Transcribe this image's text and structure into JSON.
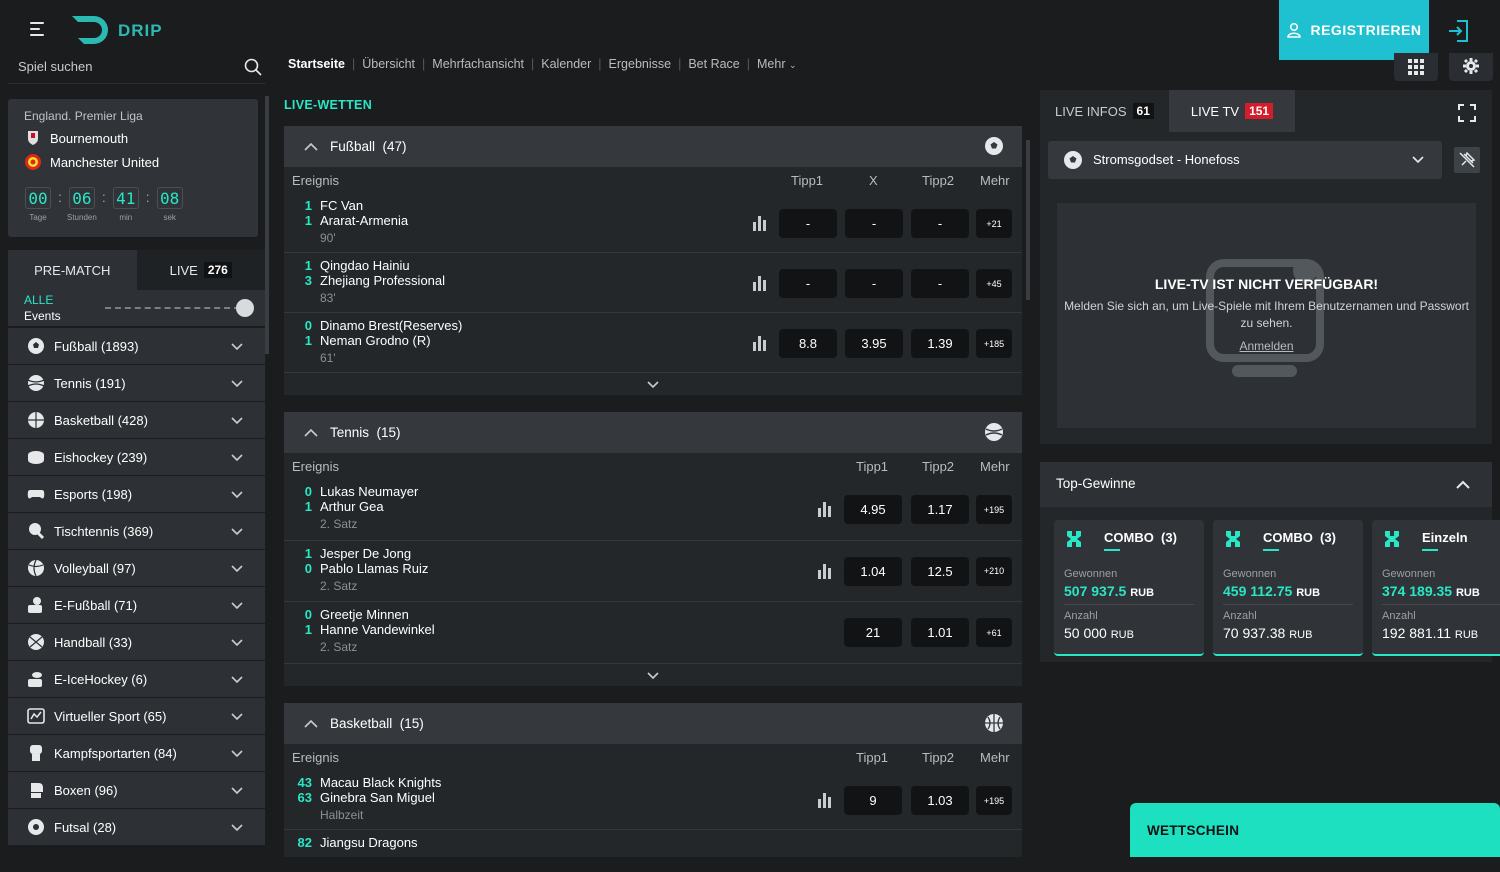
{
  "header": {
    "logo_text": "DRIP",
    "register_label": "REGISTRIEREN",
    "accent_color": "#1fc0cf"
  },
  "search": {
    "placeholder": "Spiel suchen"
  },
  "topnav": [
    "Startseite",
    "Übersicht",
    "Mehrfachansicht",
    "Kalender",
    "Ergebnisse",
    "Bet Race",
    "Mehr"
  ],
  "live_card": {
    "league": "England. Premier Liga",
    "team1": "Bournemouth",
    "team2": "Manchester United",
    "countdown": [
      {
        "value": "00",
        "label": "Tage"
      },
      {
        "value": "06",
        "label": "Stunden"
      },
      {
        "value": "41",
        "label": "min"
      },
      {
        "value": "08",
        "label": "sek"
      }
    ]
  },
  "mode_tabs": {
    "prematch": "PRE-MATCH",
    "live": "LIVE",
    "live_count": "276"
  },
  "filter": {
    "alle": "ALLE",
    "events": "Events"
  },
  "sports": [
    {
      "label": "Fußball (1893)",
      "icon": "soccer-ball-icon"
    },
    {
      "label": "Tennis (191)",
      "icon": "tennis-ball-icon"
    },
    {
      "label": "Basketball (428)",
      "icon": "basketball-icon"
    },
    {
      "label": "Eishockey (239)",
      "icon": "hockey-puck-icon"
    },
    {
      "label": "Esports (198)",
      "icon": "gamepad-icon"
    },
    {
      "label": "Tischtennis (369)",
      "icon": "table-tennis-icon"
    },
    {
      "label": "Volleyball (97)",
      "icon": "volleyball-icon"
    },
    {
      "label": "E-Fußball (71)",
      "icon": "e-football-icon"
    },
    {
      "label": "Handball (33)",
      "icon": "handball-icon"
    },
    {
      "label": "E-IceHockey (6)",
      "icon": "e-icehockey-icon"
    },
    {
      "label": "Virtueller Sport (65)",
      "icon": "virtual-sport-icon"
    },
    {
      "label": "Kampfsportarten (84)",
      "icon": "martial-arts-icon"
    },
    {
      "label": "Boxen (96)",
      "icon": "boxing-glove-icon"
    },
    {
      "label": "Futsal (28)",
      "icon": "futsal-ball-icon"
    }
  ],
  "live_heading": "LIVE-WETTEN",
  "football": {
    "title": "Fußball  (47)",
    "cols": {
      "event": "Ereignis",
      "t1": "Tipp1",
      "x": "X",
      "t2": "Tipp2",
      "more": "Mehr"
    },
    "events": [
      {
        "s1": "1",
        "team1": "FC Van",
        "s2": "1",
        "team2": "Ararat-Armenia",
        "time": "90'",
        "o1": "-",
        "ox": "-",
        "o2": "-",
        "more": "+21"
      },
      {
        "s1": "1",
        "team1": "Qingdao Hainiu",
        "s2": "3",
        "team2": "Zhejiang Professional",
        "time": "83'",
        "o1": "-",
        "ox": "-",
        "o2": "-",
        "more": "+45"
      },
      {
        "s1": "0",
        "team1": "Dinamo Brest(Reserves)",
        "s2": "1",
        "team2": "Neman Grodno (R)",
        "time": "61'",
        "o1": "8.8",
        "ox": "3.95",
        "o2": "1.39",
        "more": "+185"
      }
    ]
  },
  "tennis": {
    "title": "Tennis  (15)",
    "cols": {
      "event": "Ereignis",
      "t1": "Tipp1",
      "t2": "Tipp2",
      "more": "Mehr"
    },
    "events": [
      {
        "s1": "0",
        "team1": "Lukas Neumayer",
        "s2": "1",
        "team2": "Arthur Gea",
        "time": "2. Satz",
        "o1": "4.95",
        "o2": "1.17",
        "more": "+195"
      },
      {
        "s1": "1",
        "team1": "Jesper De Jong",
        "s2": "0",
        "team2": "Pablo Llamas Ruiz",
        "time": "2. Satz",
        "o1": "1.04",
        "o2": "12.5",
        "more": "+210"
      },
      {
        "s1": "0",
        "team1": "Greetje Minnen",
        "s2": "1",
        "team2": "Hanne Vandewinkel",
        "time": "2. Satz",
        "o1": "21",
        "o2": "1.01",
        "more": "+61"
      }
    ]
  },
  "basketball": {
    "title": "Basketball  (15)",
    "cols": {
      "event": "Ereignis",
      "t1": "Tipp1",
      "t2": "Tipp2",
      "more": "Mehr"
    },
    "events": [
      {
        "s1": "43",
        "team1": "Macau Black Knights",
        "s2": "63",
        "team2": "Ginebra San Miguel",
        "time": "Halbzeit",
        "o1": "9",
        "o2": "1.03",
        "more": "+195"
      },
      {
        "s1": "82",
        "team1": "Jiangsu Dragons"
      }
    ]
  },
  "right": {
    "tab_infos": "LIVE INFOS",
    "infos_count": "61",
    "tab_tv": "LIVE TV",
    "tv_count": "151",
    "match": "Stromsgodset - Honefoss",
    "tv_title": "LIVE-TV IST NICHT VERFÜGBAR!",
    "tv_msg": "Melden Sie sich an, um Live-Spiele mit Ihrem Benutzernamen und Passwort zu sehen.",
    "tv_link": "Anmelden"
  },
  "top_wins": {
    "title": "Top-Gewinne",
    "cards": [
      {
        "type": "COMBO  (3)",
        "lab1": "Gewonnen",
        "won": "507 937.5",
        "cur": "RUB",
        "lab2": "Anzahl",
        "stake": "50 000",
        "cur2": "RUB"
      },
      {
        "type": "COMBO  (3)",
        "lab1": "Gewonnen",
        "won": "459 112.75",
        "cur": "RUB",
        "lab2": "Anzahl",
        "stake": "70 937.38",
        "cur2": "RUB"
      },
      {
        "type": "Einzeln",
        "lab1": "Gewonnen",
        "won": "374 189.35",
        "cur": "RUB",
        "lab2": "Anzahl",
        "stake": "192 881.11",
        "cur2": "RUB"
      }
    ]
  },
  "betslip": "WETTSCHEIN"
}
